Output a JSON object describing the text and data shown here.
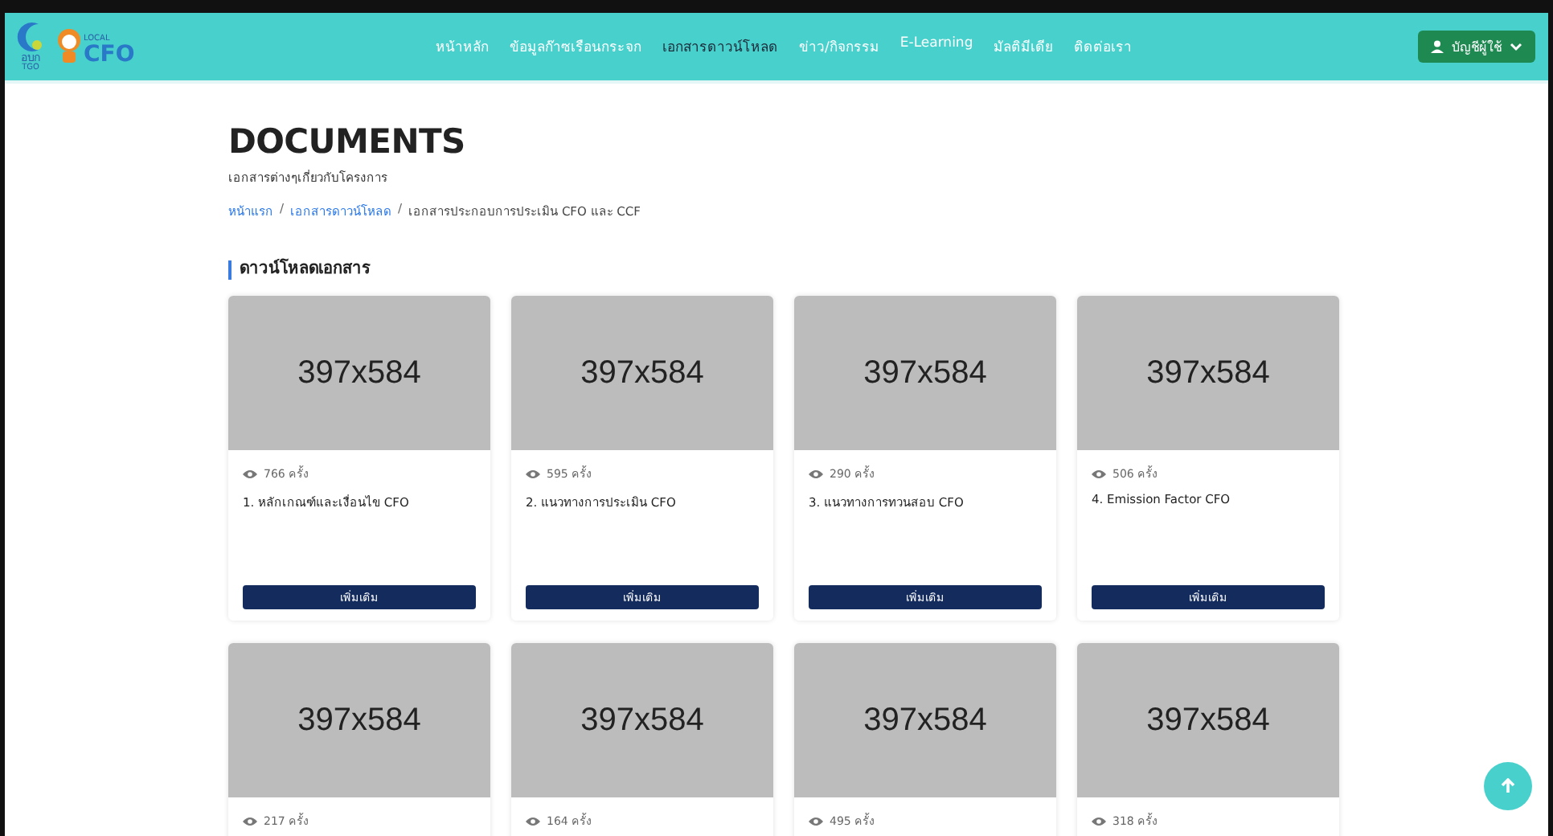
{
  "logo": {
    "mark_text": "อบก",
    "mark_sub": "TGO",
    "brand_top": "LOCAL",
    "brand": "CFO"
  },
  "nav": [
    {
      "label": "หน้าหลัก",
      "selected": false
    },
    {
      "label": "ข้อมูลก๊าซเรือนกระจก",
      "selected": false
    },
    {
      "label": "เอกสารดาวน์โหลด",
      "selected": true
    },
    {
      "label": "ข่าว/กิจกรรม",
      "selected": false
    },
    {
      "label": "E-Learning",
      "selected": false
    },
    {
      "label": "มัลติมีเดีย",
      "selected": false
    },
    {
      "label": "ติดต่อเรา",
      "selected": false
    }
  ],
  "account_button": "บัญชีผู้ใช้",
  "page_title": "DOCUMENTS",
  "page_subtitle": "เอกสารต่างๆเกี่ยวกับโครงการ",
  "breadcrumb": [
    {
      "label": "หน้าแรก",
      "kind": "link"
    },
    {
      "label": "/",
      "kind": "separator"
    },
    {
      "label": "เอกสารดาวน์โหลด",
      "kind": "link"
    },
    {
      "label": "/",
      "kind": "separator"
    },
    {
      "label": "เอกสารประกอบการประเมิน CFO และ CCF",
      "kind": "current"
    }
  ],
  "section_title": "ดาวน์โหลดเอกสาร",
  "cards": [
    {
      "image_text": "397x584",
      "views": "766 ครั้ง",
      "title": "1. หลักเกณฑ์และเงื่อนไข CFO",
      "button": "เพิ่มเติม"
    },
    {
      "image_text": "397x584",
      "views": "595 ครั้ง",
      "title": "2. แนวทางการประเมิน CFO",
      "button": "เพิ่มเติม"
    },
    {
      "image_text": "397x584",
      "views": "290 ครั้ง",
      "title": "3. แนวทางการทวนสอบ CFO",
      "button": "เพิ่มเติม"
    },
    {
      "image_text": "397x584",
      "views": "506 ครั้ง",
      "title": "4. Emission Factor CFO",
      "button": "เพิ่มเติม"
    },
    {
      "image_text": "397x584",
      "views": "217 ครั้ง"
    },
    {
      "image_text": "397x584",
      "views": "164 ครั้ง"
    },
    {
      "image_text": "397x584",
      "views": "495 ครั้ง"
    },
    {
      "image_text": "397x584",
      "views": "318 ครั้ง"
    }
  ]
}
